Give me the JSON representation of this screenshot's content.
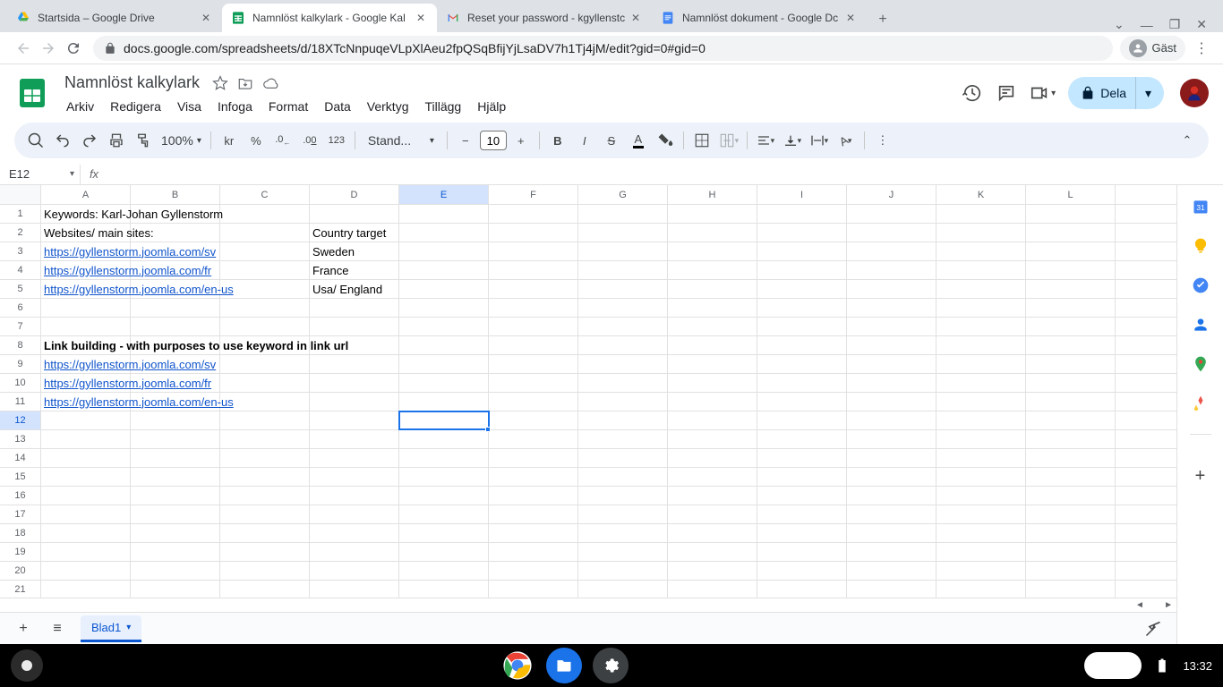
{
  "browser": {
    "tabs": [
      {
        "title": "Startsida – Google Drive"
      },
      {
        "title": "Namnlöst kalkylark - Google Kal"
      },
      {
        "title": "Reset your password - kgyllenstc"
      },
      {
        "title": "Namnlöst dokument - Google Dc"
      }
    ],
    "url": "docs.google.com/spreadsheets/d/18XTcNnpuqeVLpXlAeu2fpQSqBfijYjLsaDV7h1Tj4jM/edit?gid=0#gid=0",
    "guest_label": "Gäst"
  },
  "doc": {
    "title": "Namnlöst kalkylark",
    "menus": [
      "Arkiv",
      "Redigera",
      "Visa",
      "Infoga",
      "Format",
      "Data",
      "Verktyg",
      "Tillägg",
      "Hjälp"
    ],
    "share_label": "Dela"
  },
  "toolbar": {
    "zoom": "100%",
    "currency": "kr",
    "percent": "%",
    "dec_minus": ".0",
    "dec_plus": ".00",
    "num123": "123",
    "font": "Stand...",
    "font_size": "10"
  },
  "namebox": "E12",
  "columns": [
    "A",
    "B",
    "C",
    "D",
    "E",
    "F",
    "G",
    "H",
    "I",
    "J",
    "K",
    "L"
  ],
  "selected_col": "E",
  "selected_row": 12,
  "rows": [
    {
      "n": 1,
      "A": "Keywords: Karl-Johan Gyllenstorm"
    },
    {
      "n": 2,
      "A": "Websites/ main sites:",
      "D": "Country target"
    },
    {
      "n": 3,
      "A": "https://gyllenstorm.joomla.com/sv",
      "A_link": true,
      "D": "Sweden"
    },
    {
      "n": 4,
      "A": "https://gyllenstorm.joomla.com/fr",
      "A_link": true,
      "D": "France"
    },
    {
      "n": 5,
      "A": "https://gyllenstorm.joomla.com/en-us",
      "A_link": true,
      "D": "Usa/ England"
    },
    {
      "n": 6
    },
    {
      "n": 7
    },
    {
      "n": 8,
      "A": "Link building - with purposes to use keyword in link url",
      "A_bold": true
    },
    {
      "n": 9,
      "A": "https://gyllenstorm.joomla.com/sv",
      "A_link": true
    },
    {
      "n": 10,
      "A": "https://gyllenstorm.joomla.com/fr",
      "A_link": true
    },
    {
      "n": 11,
      "A": "https://gyllenstorm.joomla.com/en-us",
      "A_link": true
    },
    {
      "n": 12
    },
    {
      "n": 13
    },
    {
      "n": 14
    },
    {
      "n": 15
    },
    {
      "n": 16
    },
    {
      "n": 17
    },
    {
      "n": 18
    },
    {
      "n": 19
    },
    {
      "n": 20
    },
    {
      "n": 21
    }
  ],
  "sheettab": "Blad1",
  "clock": "13:32"
}
